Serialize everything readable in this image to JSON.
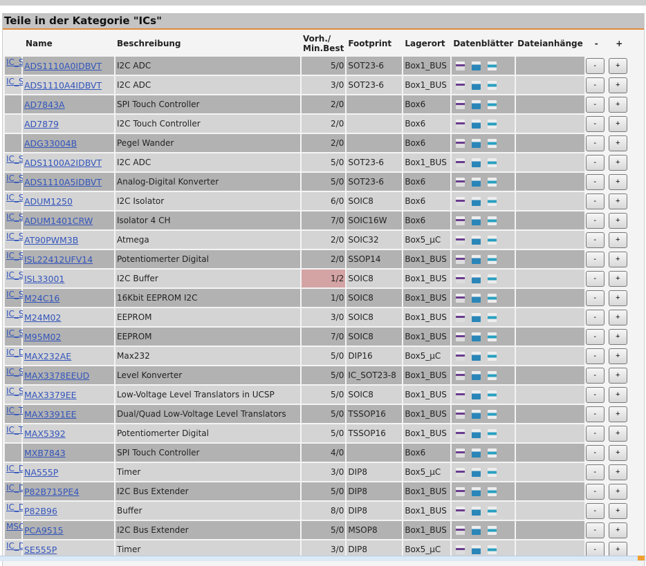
{
  "title": "Teile in der Kategorie \"ICs\"",
  "headers": {
    "name": "Name",
    "description": "Beschreibung",
    "stock_line1": "Vorh./",
    "stock_line2": "Min.Best",
    "footprint": "Footprint",
    "location": "Lagerort",
    "datasheets": "Datenblätter",
    "attachments": "Dateianhänge",
    "minus": "-",
    "plus": "+"
  },
  "buttons": {
    "minus": "-",
    "plus": "+"
  },
  "colors": {
    "accent": "#e08a3c",
    "low_stock": "#d4a3a3",
    "link": "#3355bb"
  },
  "rows": [
    {
      "fp_img": "IC_SOT23-6",
      "name": "ADS1110A0IDBVT",
      "desc": "I2C ADC",
      "stock": "5/0",
      "footprint": "SOT23-6",
      "location": "Box1_BUS"
    },
    {
      "fp_img": "IC_SOT23-6",
      "name": "ADS1110A4IDBVT",
      "desc": "I2C ADC",
      "stock": "3/0",
      "footprint": "SOT23-6",
      "location": "Box1_BUS"
    },
    {
      "fp_img": "",
      "name": "AD7843A",
      "desc": "SPI Touch Controller",
      "stock": "2/0",
      "footprint": "",
      "location": "Box6"
    },
    {
      "fp_img": "",
      "name": "AD7879",
      "desc": "I2C Touch Controller",
      "stock": "2/0",
      "footprint": "",
      "location": "Box6"
    },
    {
      "fp_img": "",
      "name": "ADG33004B",
      "desc": "Pegel Wander",
      "stock": "2/0",
      "footprint": "",
      "location": "Box6"
    },
    {
      "fp_img": "IC_SOT23-6",
      "name": "ADS1100A2IDBVT",
      "desc": "I2C ADC",
      "stock": "5/0",
      "footprint": "SOT23-6",
      "location": "Box1_BUS"
    },
    {
      "fp_img": "IC_SOT23-6",
      "name": "ADS1110A5IDBVT",
      "desc": "Analog-Digital Konverter",
      "stock": "5/0",
      "footprint": "SOT23-6",
      "location": "Box6"
    },
    {
      "fp_img": "IC_SO08",
      "name": "ADUM1250",
      "desc": "I2C Isolator",
      "stock": "6/0",
      "footprint": "SOIC8",
      "location": "Box6"
    },
    {
      "fp_img": "IC_SO16W",
      "name": "ADUM1401CRW",
      "desc": "Isolator 4 CH",
      "stock": "7/0",
      "footprint": "SOIC16W",
      "location": "Box6"
    },
    {
      "fp_img": "IC_SO32-400",
      "name": "AT90PWM3B",
      "desc": "Atmega",
      "stock": "2/0",
      "footprint": "SOIC32",
      "location": "Box5_µC"
    },
    {
      "fp_img": "IC_SSOP14",
      "name": "ISL22412UFV14",
      "desc": "Potentiomerter Digital",
      "stock": "2/0",
      "footprint": "SSOP14",
      "location": "Box1_BUS"
    },
    {
      "fp_img": "IC_SO08",
      "name": "ISL33001",
      "desc": "I2C Buffer",
      "stock": "1/2",
      "footprint": "SOIC8",
      "location": "Box1_BUS",
      "low": true
    },
    {
      "fp_img": "IC_SO08",
      "name": "M24C16",
      "desc": "16Kbit EEPROM I2C",
      "stock": "1/0",
      "footprint": "SOIC8",
      "location": "Box1_BUS"
    },
    {
      "fp_img": "IC_SO08",
      "name": "M24M02",
      "desc": "EEPROM",
      "stock": "3/0",
      "footprint": "SOIC8",
      "location": "Box1_BUS"
    },
    {
      "fp_img": "IC_SO08",
      "name": "M95M02",
      "desc": "EEPROM",
      "stock": "7/0",
      "footprint": "SOIC8",
      "location": "Box1_BUS"
    },
    {
      "fp_img": "IC_DIP16",
      "name": "MAX232AE",
      "desc": "Max232",
      "stock": "5/0",
      "footprint": "DIP16",
      "location": "Box5_µC"
    },
    {
      "fp_img": "IC_SOT23-8",
      "name": "MAX3378EEUD",
      "desc": "Level Konverter",
      "stock": "5/0",
      "footprint": "IC_SOT23-8",
      "location": "Box1_BUS"
    },
    {
      "fp_img": "IC_SO08",
      "name": "MAX3379EE",
      "desc": "Low-Voltage Level Translators in UCSP",
      "stock": "5/0",
      "footprint": "SOIC8",
      "location": "Box1_BUS"
    },
    {
      "fp_img": "IC_TSSOP16",
      "name": "MAX3391EE",
      "desc": "Dual/Quad Low-Voltage Level Translators",
      "stock": "5/0",
      "footprint": "TSSOP16",
      "location": "Box1_BUS"
    },
    {
      "fp_img": "IC_TSSOP16",
      "name": "MAX5392",
      "desc": "Potentiomerter Digital",
      "stock": "5/0",
      "footprint": "TSSOP16",
      "location": "Box1_BUS"
    },
    {
      "fp_img": "",
      "name": "MXB7843",
      "desc": "SPI Touch Controller",
      "stock": "4/0",
      "footprint": "",
      "location": "Box6"
    },
    {
      "fp_img": "IC_DIP08",
      "name": "NA555P",
      "desc": "Timer",
      "stock": "3/0",
      "footprint": "DIP8",
      "location": "Box5_µC"
    },
    {
      "fp_img": "IC_DIP08",
      "name": "P82B715PE4",
      "desc": "I2C Bus Extender",
      "stock": "5/0",
      "footprint": "DIP8",
      "location": "Box1_BUS"
    },
    {
      "fp_img": "IC_DIP08",
      "name": "P82B96",
      "desc": "Buffer",
      "stock": "8/0",
      "footprint": "DIP8",
      "location": "Box1_BUS"
    },
    {
      "fp_img": "MSOP8",
      "name": "PCA9515",
      "desc": "I2C Bus Extender",
      "stock": "5/0",
      "footprint": "MSOP8",
      "location": "Box1_BUS"
    },
    {
      "fp_img": "IC_DIP08",
      "name": "SE555P",
      "desc": "Timer",
      "stock": "3/0",
      "footprint": "DIP8",
      "location": "Box5_µC"
    }
  ]
}
